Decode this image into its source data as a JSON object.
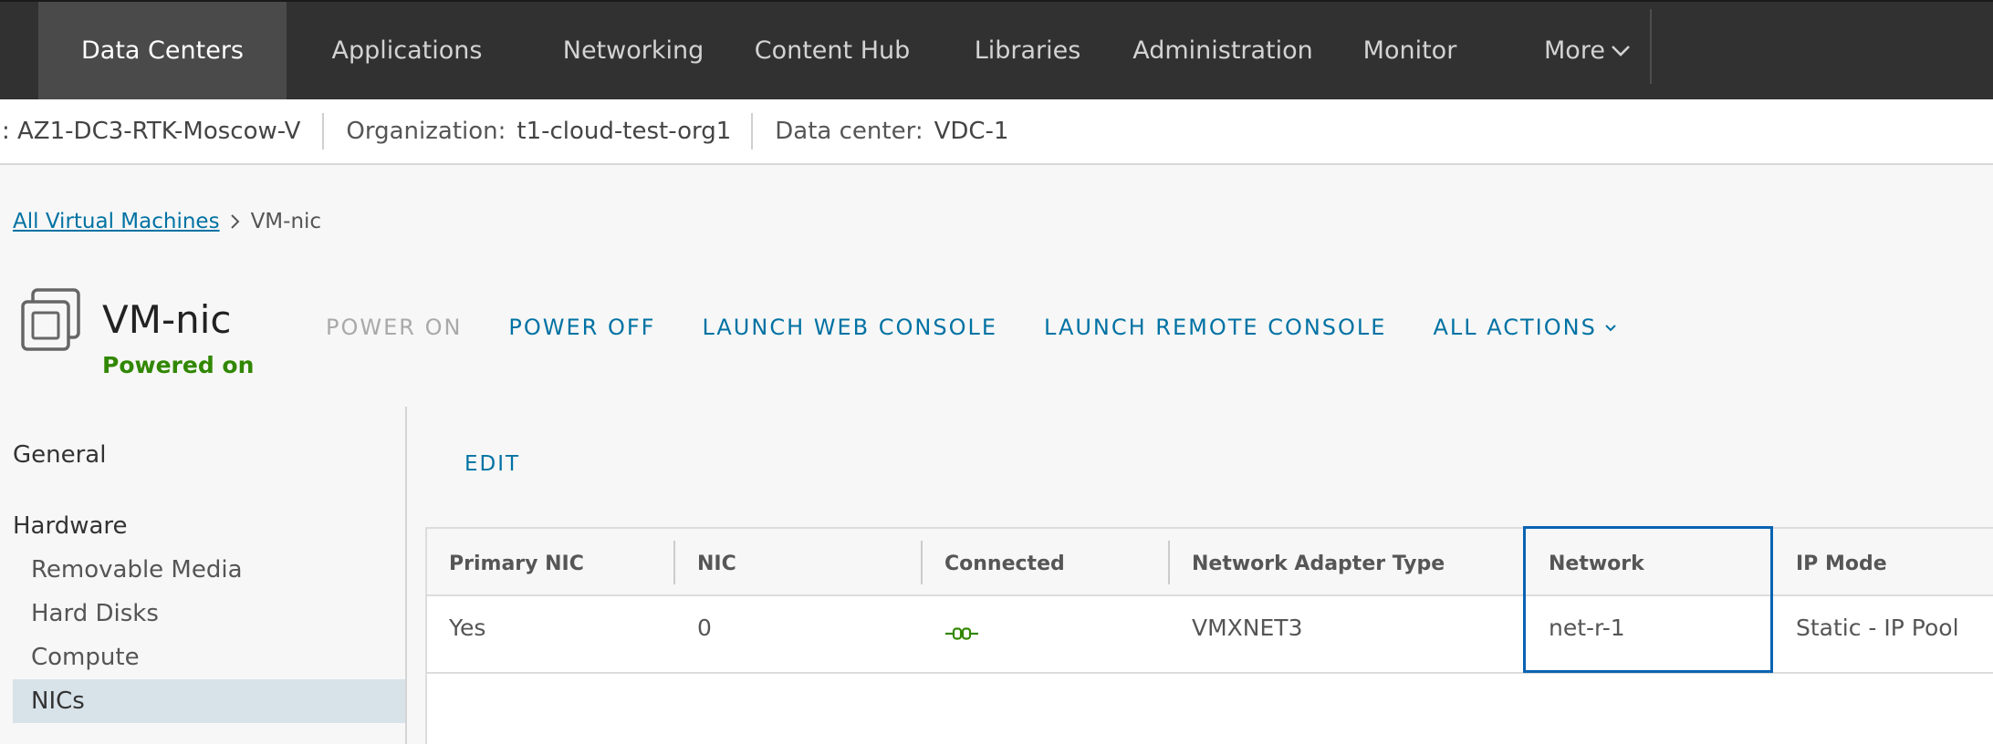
{
  "nav": {
    "items": [
      "Data Centers",
      "Applications",
      "Networking",
      "Content Hub",
      "Libraries",
      "Administration",
      "Monitor"
    ],
    "more_label": "More",
    "active": "Data Centers"
  },
  "context": {
    "site_value": ": AZ1-DC3-RTK-Moscow-V",
    "org_label": "Organization:",
    "org_value": "t1-cloud-test-org1",
    "dc_label": "Data center:",
    "dc_value": "VDC-1"
  },
  "breadcrumb": {
    "parent": "All Virtual Machines",
    "current": "VM-nic"
  },
  "vm": {
    "name": "VM-nic",
    "status": "Powered on",
    "status_color": "#318700"
  },
  "actions": {
    "power_on": "POWER ON",
    "power_off": "POWER OFF",
    "web_console": "LAUNCH WEB CONSOLE",
    "remote_console": "LAUNCH REMOTE CONSOLE",
    "all_actions": "ALL ACTIONS"
  },
  "sidebar": {
    "general": "General",
    "hardware": "Hardware",
    "items": [
      "Removable Media",
      "Hard Disks",
      "Compute",
      "NICs"
    ],
    "active": "NICs"
  },
  "main": {
    "edit_label": "EDIT",
    "table": {
      "columns": [
        "Primary NIC",
        "NIC",
        "Connected",
        "Network Adapter Type",
        "Network",
        "IP Mode"
      ],
      "rows": [
        {
          "primary_nic": "Yes",
          "nic": "0",
          "connected_icon": "connected-plug-icon",
          "adapter_type": "VMXNET3",
          "network": "net-r-1",
          "ip_mode": "Static - IP Pool"
        }
      ]
    }
  },
  "colors": {
    "accent": "#0072a3",
    "nav_bg": "#313131",
    "success": "#318700",
    "focus": "#0a63b2"
  }
}
